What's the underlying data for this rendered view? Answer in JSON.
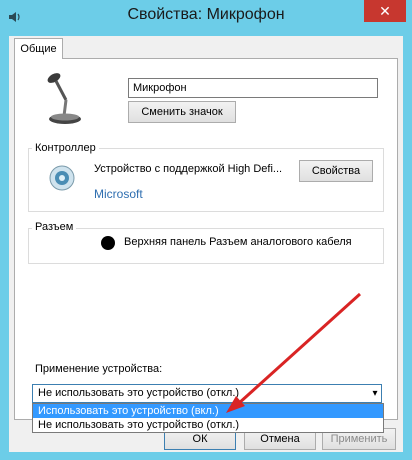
{
  "window": {
    "title": "Свойства: Микрофон",
    "close_label": "✕"
  },
  "tabs": [
    {
      "label": "Общие"
    }
  ],
  "general": {
    "device_name_value": "Микрофон",
    "change_icon_label": "Сменить значок"
  },
  "controller": {
    "group_label": "Контроллер",
    "device": "Устройство с поддержкой High Defi...",
    "properties_label": "Свойства",
    "vendor": "Microsoft"
  },
  "jack": {
    "group_label": "Разъем",
    "info": "Верхняя панель Разъем аналогового кабеля"
  },
  "usage": {
    "label": "Применение устройства:",
    "selected": "Не использовать это устройство (откл.)",
    "options": [
      "Использовать это устройство (вкл.)",
      "Не использовать это устройство (откл.)"
    ]
  },
  "footer": {
    "ok_label": "ОК",
    "cancel_label": "Отмена",
    "apply_label": "Применить"
  },
  "colors": {
    "title_bar": "#6ccde8",
    "close_button": "#c7372f",
    "selection": "#3399ff",
    "annotation_arrow": "#d92424"
  }
}
